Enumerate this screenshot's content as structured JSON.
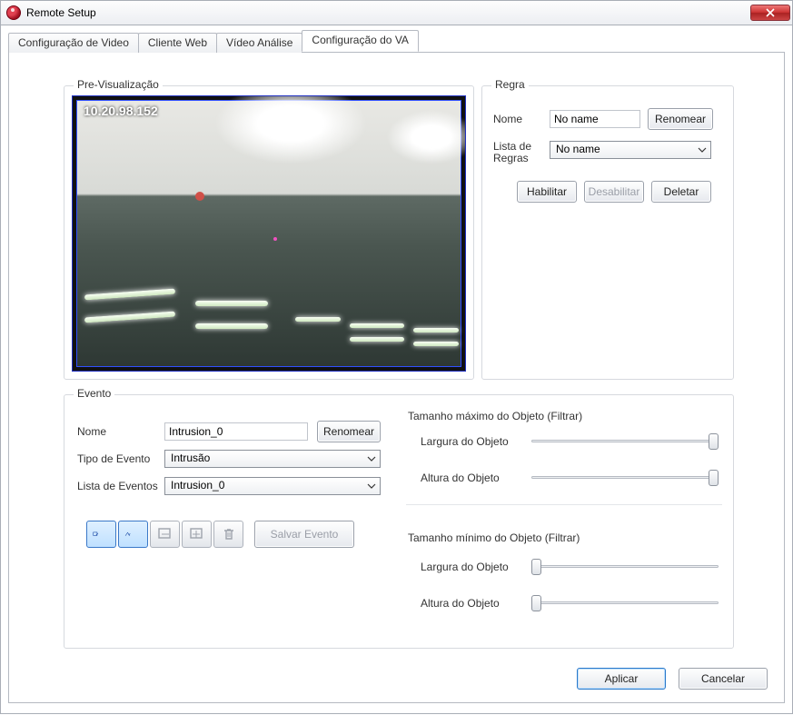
{
  "window": {
    "title": "Remote Setup"
  },
  "tabs": {
    "items": [
      "Configuração de Video",
      "Cliente Web",
      "Vídeo Análise",
      "Configuração do VA"
    ],
    "active": 3
  },
  "preview": {
    "legend": "Pre-Visualização",
    "ip": "10.20.98.152"
  },
  "regra": {
    "legend": "Regra",
    "nome_label": "Nome",
    "nome_value": "No name",
    "renomear": "Renomear",
    "lista_label": "Lista de Regras",
    "lista_value": "No name",
    "habilitar": "Habilitar",
    "desabilitar": "Desabilitar",
    "deletar": "Deletar"
  },
  "evento": {
    "legend": "Evento",
    "nome_label": "Nome",
    "nome_value": "Intrusion_0",
    "renomear": "Renomear",
    "tipo_label": "Tipo de Evento",
    "tipo_value": "Intrusão",
    "lista_label": "Lista de Eventos",
    "lista_value": "Intrusion_0",
    "salvar": "Salvar Evento"
  },
  "filtrar_max": {
    "legend": "Tamanho máximo do Objeto (Filtrar)",
    "largura": "Largura do Objeto",
    "altura": "Altura do Objeto"
  },
  "filtrar_min": {
    "legend": "Tamanho mínimo do Objeto (Filtrar)",
    "largura": "Largura do Objeto",
    "altura": "Altura do Objeto"
  },
  "buttons": {
    "aplicar": "Aplicar",
    "cancelar": "Cancelar"
  }
}
